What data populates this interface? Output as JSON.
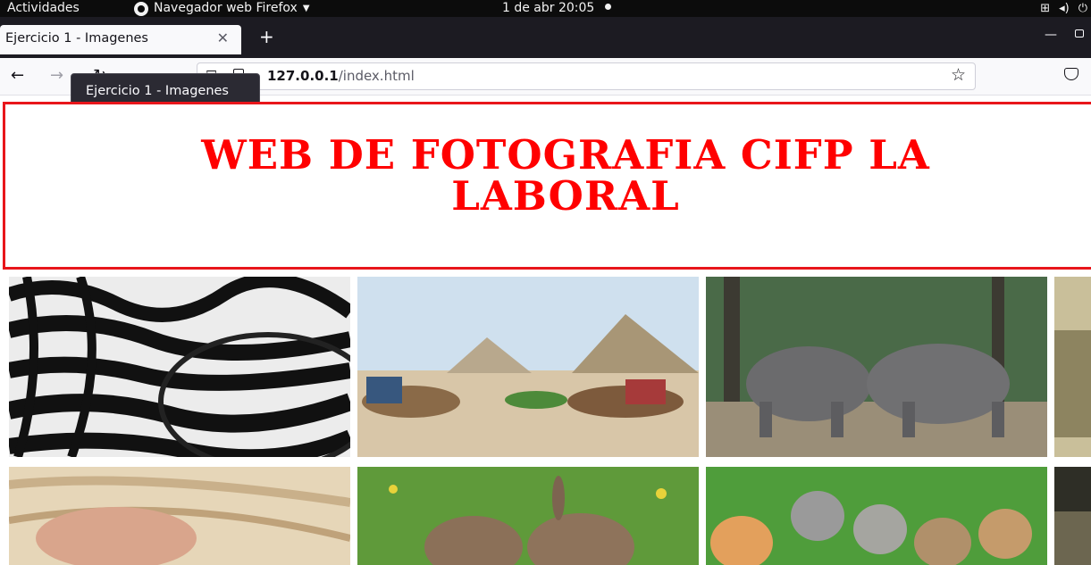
{
  "topbar": {
    "activities": "Actividades",
    "app_name": "Navegador web Firefox",
    "clock": "1 de abr  20:05"
  },
  "browser": {
    "tab_title": "Ejercicio 1 - Imagenes",
    "url_host": "127.0.0.1",
    "url_path": "/index.html",
    "tooltip": "Ejercicio 1 - Imagenes"
  },
  "page": {
    "title_line1": "WEB DE FOTOGRAFIA CIFP LA",
    "title_line2": "LABORAL",
    "title_color": "#ff0000",
    "border_color": "#e8161b"
  },
  "gallery": {
    "images": [
      {
        "subject": "zebras",
        "row": 1
      },
      {
        "subject": "camels-and-pyramids",
        "row": 1
      },
      {
        "subject": "elephants",
        "row": 1
      },
      {
        "subject": "savanna-partial",
        "row": 1
      },
      {
        "subject": "hand-in-fur",
        "row": 2
      },
      {
        "subject": "rabbits",
        "row": 2
      },
      {
        "subject": "kittens",
        "row": 2
      },
      {
        "subject": "partial-image",
        "row": 2
      }
    ]
  }
}
